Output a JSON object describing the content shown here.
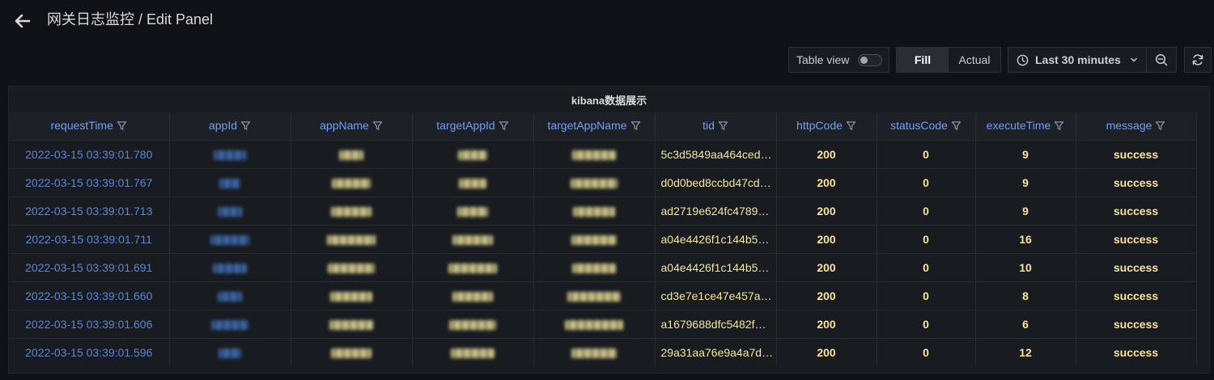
{
  "header": {
    "title": "网关日志监控 / Edit Panel"
  },
  "toolbar": {
    "table_view_label": "Table view",
    "fill_label": "Fill",
    "actual_label": "Actual",
    "time_range_label": "Last 30 minutes"
  },
  "panel": {
    "title": "kibana数据展示",
    "columns": [
      "requestTime",
      "appId",
      "appName",
      "targetAppId",
      "targetAppName",
      "tid",
      "httpCode",
      "statusCode",
      "executeTime",
      "message"
    ],
    "rows": [
      {
        "requestTime": "2022-03-15 03:39:01.780",
        "tid": "5c3d5849aa464ced…",
        "httpCode": "200",
        "statusCode": "0",
        "executeTime": "9",
        "message": "success"
      },
      {
        "requestTime": "2022-03-15 03:39:01.767",
        "tid": "d0d0bed8ccbd47cd…",
        "httpCode": "200",
        "statusCode": "0",
        "executeTime": "9",
        "message": "success"
      },
      {
        "requestTime": "2022-03-15 03:39:01.713",
        "tid": "ad2719e624fc4789…",
        "httpCode": "200",
        "statusCode": "0",
        "executeTime": "9",
        "message": "success"
      },
      {
        "requestTime": "2022-03-15 03:39:01.711",
        "tid": "a04e4426f1c144b5…",
        "httpCode": "200",
        "statusCode": "0",
        "executeTime": "16",
        "message": "success"
      },
      {
        "requestTime": "2022-03-15 03:39:01.691",
        "tid": "a04e4426f1c144b5…",
        "httpCode": "200",
        "statusCode": "0",
        "executeTime": "10",
        "message": "success"
      },
      {
        "requestTime": "2022-03-15 03:39:01.660",
        "tid": "cd3e7e1ce47e457a…",
        "httpCode": "200",
        "statusCode": "0",
        "executeTime": "8",
        "message": "success"
      },
      {
        "requestTime": "2022-03-15 03:39:01.606",
        "tid": "a1679688dfc5482f…",
        "httpCode": "200",
        "statusCode": "0",
        "executeTime": "6",
        "message": "success"
      },
      {
        "requestTime": "2022-03-15 03:39:01.596",
        "tid": "29a31aa76e9a4a7d…",
        "httpCode": "200",
        "statusCode": "0",
        "executeTime": "12",
        "message": "success"
      }
    ]
  },
  "colors": {
    "background": "#111217",
    "header_text": "#6e9fff",
    "time_text": "#5b86d6",
    "value_text": "#fae29b"
  },
  "icons": {
    "back": "arrow-left-icon",
    "clock": "clock-icon",
    "chevron": "chevron-down-icon",
    "zoom_out": "zoom-out-icon",
    "refresh": "refresh-icon",
    "filter": "filter-icon"
  }
}
